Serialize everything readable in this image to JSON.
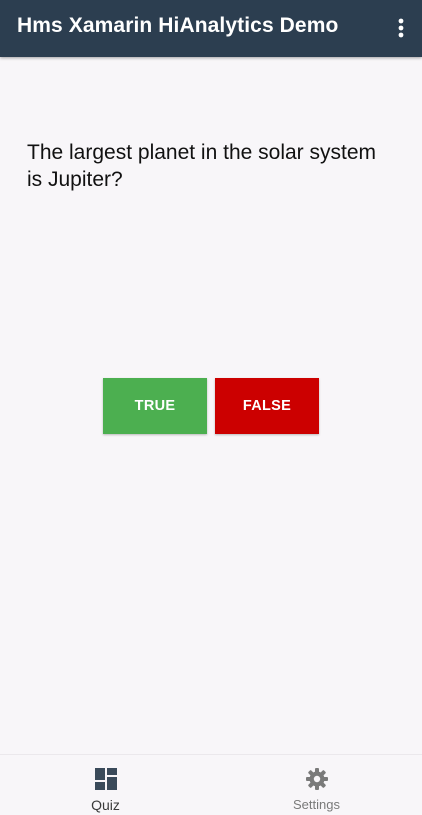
{
  "app_bar": {
    "title": "Hms Xamarin HiAnalytics Demo",
    "background_color": "#2c3e50",
    "overflow_icon": "more-vert-icon"
  },
  "quiz": {
    "question": "The largest planet in the solar system is Jupiter?",
    "true_label": "TRUE",
    "false_label": "FALSE",
    "true_color": "#4caf50",
    "false_color": "#cc0000"
  },
  "bottom_nav": {
    "items": [
      {
        "label": "Quiz",
        "icon": "dashboard-icon",
        "selected": true
      },
      {
        "label": "Settings",
        "icon": "gear-icon",
        "selected": false
      }
    ]
  }
}
